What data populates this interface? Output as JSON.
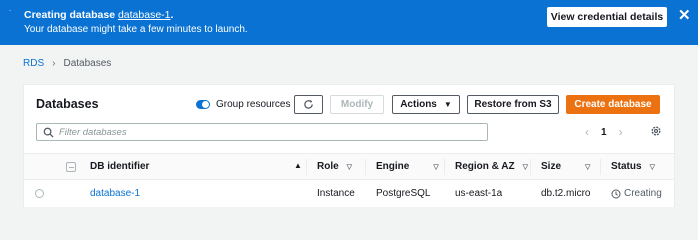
{
  "flash": {
    "dot": "˙",
    "line1_prefix": "Creating database ",
    "db_link": "database-1",
    "line1_suffix": ".",
    "line2": "Your database might take a few minutes to launch.",
    "button": "View credential details",
    "close": "✕",
    "color": "#0972d3"
  },
  "breadcrumb": {
    "root": "RDS",
    "separator": "›",
    "current": "Databases"
  },
  "panel": {
    "title": "Databases",
    "group_toggle_label": "Group resources",
    "group_toggle_on": true,
    "buttons": {
      "modify": "Modify",
      "actions": "Actions",
      "actions_caret": "▼",
      "restore": "Restore from S3",
      "create": "Create database"
    },
    "search_placeholder": "Filter databases",
    "pager": {
      "prev": "‹",
      "page": "1",
      "next": "›"
    },
    "accent_color": "#ec7211"
  },
  "table": {
    "columns": {
      "db_identifier": "DB identifier",
      "db_identifier_sort": "▲",
      "role": "Role",
      "engine": "Engine",
      "region": "Region & AZ",
      "size": "Size",
      "status": "Status",
      "filter_glyph": "▽"
    },
    "rows": [
      {
        "db_identifier": "database-1",
        "role": "Instance",
        "engine": "PostgreSQL",
        "region": "us-east-1a",
        "size": "db.t2.micro",
        "status": "Creating"
      }
    ]
  }
}
